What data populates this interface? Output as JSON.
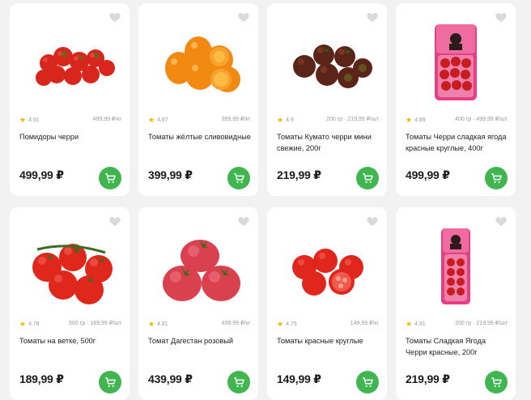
{
  "colors": {
    "accent": "#3fb650",
    "star": "#f5b400",
    "favorite": "#dadada",
    "background": "#f2f2f2"
  },
  "icons": {
    "favorite": "heart-icon",
    "cart": "shopping-cart-icon",
    "rating": "star-icon"
  },
  "products": [
    {
      "rating": "4.91",
      "price_per_unit": "499,99 ₽/кг",
      "name": "Помидоры черри",
      "price": "499,99 ₽"
    },
    {
      "rating": "4.87",
      "price_per_unit": "399,99 ₽/кг",
      "name": "Томаты жёлтые сливовидные",
      "price": "399,99 ₽"
    },
    {
      "rating": "4.9",
      "price_per_unit": "200 гр · 219,99 ₽/шт",
      "name": "Томаты Кумато черри мини свежие, 200г",
      "price": "219,99 ₽"
    },
    {
      "rating": "4.89",
      "price_per_unit": "400 гр · 499,99 ₽/шт",
      "name": "Томаты Черри сладкая ягода красные круглые, 400г",
      "price": "499,99 ₽"
    },
    {
      "rating": "4.78",
      "price_per_unit": "500 гр · 189,99 ₽/шт",
      "name": "Томаты на ветке, 500г",
      "price": "189,99 ₽"
    },
    {
      "rating": "4.81",
      "price_per_unit": "439,99 ₽/кг",
      "name": "Томат Дагестан розовый",
      "price": "439,99 ₽"
    },
    {
      "rating": "4.75",
      "price_per_unit": "149,99 ₽/кг",
      "name": "Томаты красные круглые",
      "price": "149,99 ₽"
    },
    {
      "rating": "4.91",
      "price_per_unit": "200 гр · 219,99 ₽/шт",
      "name": "Томаты Сладкая Ягода Черри красные, 200г",
      "price": "219,99 ₽"
    }
  ]
}
